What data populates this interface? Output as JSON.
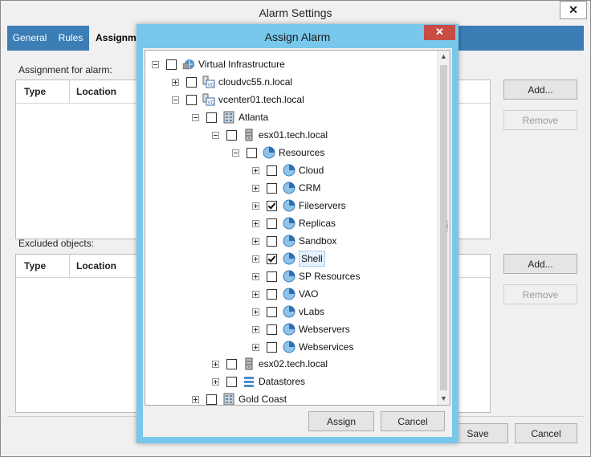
{
  "window": {
    "title": "Alarm Settings",
    "close_glyph": "✕"
  },
  "tabs": [
    {
      "label": "General"
    },
    {
      "label": "Rules"
    },
    {
      "label": "Assignme"
    }
  ],
  "assignment": {
    "label": "Assignment for alarm:",
    "columns": [
      "Type",
      "Location"
    ],
    "add_label": "Add...",
    "remove_label": "Remove"
  },
  "excluded": {
    "label": "Excluded objects:",
    "columns": [
      "Type",
      "Location"
    ],
    "add_label": "Add...",
    "remove_label": "Remove"
  },
  "footer": {
    "save_label": "Save",
    "cancel_label": "Cancel"
  },
  "modal": {
    "title": "Assign Alarm",
    "close_glyph": "✕",
    "assign_label": "Assign",
    "cancel_label": "Cancel",
    "tree": [
      {
        "label": "Virtual Infrastructure",
        "icon": "virtual-infrastructure-icon",
        "expander": "minus",
        "checked": false
      },
      {
        "label": "cloudvc55.n.local",
        "icon": "vcenter-icon",
        "expander": "plus",
        "checked": false
      },
      {
        "label": "vcenter01.tech.local",
        "icon": "vcenter-icon",
        "expander": "minus",
        "checked": false
      },
      {
        "label": "Atlanta",
        "icon": "datacenter-icon",
        "expander": "minus",
        "checked": false
      },
      {
        "label": "esx01.tech.local",
        "icon": "host-icon",
        "expander": "minus",
        "checked": false
      },
      {
        "label": "Resources",
        "icon": "resource-pool-icon",
        "expander": "minus",
        "checked": false
      },
      {
        "label": "Cloud",
        "icon": "resource-pool-icon",
        "expander": "plus",
        "checked": false
      },
      {
        "label": "CRM",
        "icon": "resource-pool-icon",
        "expander": "plus",
        "checked": false
      },
      {
        "label": "Fileservers",
        "icon": "resource-pool-icon",
        "expander": "plus",
        "checked": true
      },
      {
        "label": "Replicas",
        "icon": "resource-pool-icon",
        "expander": "plus",
        "checked": false
      },
      {
        "label": "Sandbox",
        "icon": "resource-pool-icon",
        "expander": "plus",
        "checked": false
      },
      {
        "label": "Shell",
        "icon": "resource-pool-icon",
        "expander": "plus",
        "checked": true,
        "selected": true
      },
      {
        "label": "SP Resources",
        "icon": "resource-pool-icon",
        "expander": "plus",
        "checked": false
      },
      {
        "label": "VAO",
        "icon": "resource-pool-icon",
        "expander": "plus",
        "checked": false
      },
      {
        "label": "vLabs",
        "icon": "resource-pool-icon",
        "expander": "plus",
        "checked": false
      },
      {
        "label": "Webservers",
        "icon": "resource-pool-icon",
        "expander": "plus",
        "checked": false
      },
      {
        "label": "Webservices",
        "icon": "resource-pool-icon",
        "expander": "plus",
        "checked": false
      },
      {
        "label": "esx02.tech.local",
        "icon": "host-icon",
        "expander": "plus",
        "checked": false
      },
      {
        "label": "Datastores",
        "icon": "datastores-icon",
        "expander": "plus",
        "checked": false
      },
      {
        "label": "Gold Coast",
        "icon": "datacenter-icon",
        "expander": "plus",
        "checked": false
      }
    ]
  },
  "colors": {
    "tab_bar": "#3b7db5",
    "modal_frame": "#79c7ea",
    "modal_close": "#c74d45"
  }
}
